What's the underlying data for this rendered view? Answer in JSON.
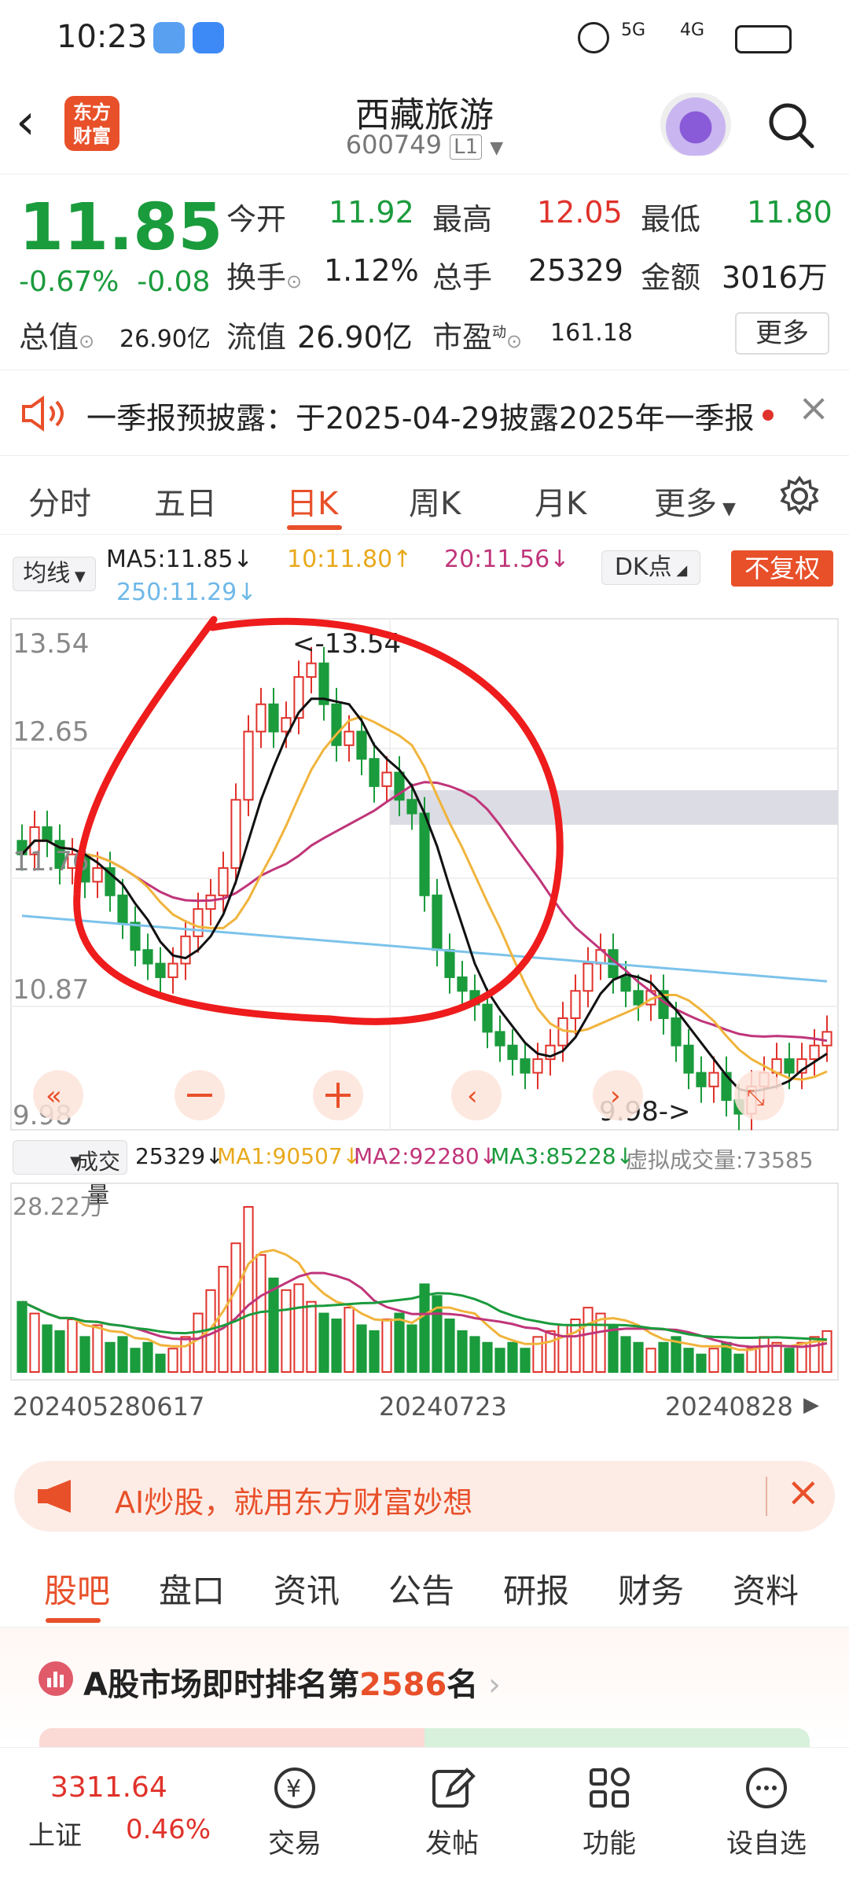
{
  "status": {
    "time": "10:23",
    "sig1": "5G",
    "sig2": "4G"
  },
  "header": {
    "logo_line1": "东方",
    "logo_line2": "财富",
    "title": "西藏旅游",
    "code": "600749",
    "level": "L1"
  },
  "quote": {
    "price": "11.85",
    "change_pct": "-0.67%",
    "change": "-0.08",
    "open_label": "今开",
    "open": "11.92",
    "high_label": "最高",
    "high": "12.05",
    "low_label": "最低",
    "low": "11.80",
    "turnover_label": "换手",
    "turnover": "1.12%",
    "volume_label": "总手",
    "volume": "25329",
    "amount_label": "金额",
    "amount": "3016万",
    "mktcap_label": "总值",
    "mktcap": "26.90亿",
    "float_label": "流值",
    "float": "26.90亿",
    "pe_label": "市盈",
    "pe_sup": "动",
    "pe": "161.18",
    "more": "更多"
  },
  "notice": {
    "text": "一季报预披露：于2025-04-29披露2025年一季报"
  },
  "tabs": [
    "分时",
    "五日",
    "日K",
    "周K",
    "月K",
    "更多"
  ],
  "ma": {
    "selector": "均线",
    "ma5": "MA5:11.85↓",
    "ma10": "10:11.80↑",
    "ma20": "20:11.56↓",
    "ma250": "250:11.29↓",
    "dk": "DK点",
    "fq": "不复权"
  },
  "chart_labels": {
    "y_top": "13.54",
    "y2": "12.65",
    "y3": "11.76",
    "y4": "10.87",
    "y_bottom": "9.98",
    "max_note": "<-13.54",
    "min_note": "9.98->"
  },
  "vol": {
    "selector": "成交量",
    "v": "25329↓",
    "ma1": "MA1:90507↓",
    "ma2": "MA2:92280↓",
    "ma3": "MA3:85228↓",
    "virtual": "虚拟成交量:73585",
    "max": "28.22万"
  },
  "dates": [
    "20240528",
    "0617",
    "20240723",
    "20240828"
  ],
  "banner": {
    "text": "AI炒股，就用东方财富妙想"
  },
  "bottom_tabs": [
    "股吧",
    "盘口",
    "资讯",
    "公告",
    "研报",
    "财务",
    "资料"
  ],
  "rank": {
    "prefix": "A股市场即时排名第",
    "num": "2586",
    "suffix": "名"
  },
  "footer": {
    "index_value": "3311.64",
    "index_name": "上证",
    "index_pct": "0.46%",
    "trade": "交易",
    "post": "发帖",
    "func": "功能",
    "watch": "设自选"
  },
  "colors": {
    "up": "#e0322b",
    "down": "#1a9b3c",
    "accent": "#e8502a"
  },
  "chart_data": {
    "type": "candlestick",
    "ylim": [
      9.98,
      13.54
    ],
    "high_point": 13.54,
    "low_point": 9.98,
    "x_ticks": [
      "20240528",
      "0617",
      "20240723",
      "20240828"
    ],
    "closes": [
      11.9,
      12.1,
      12.0,
      11.8,
      11.9,
      11.7,
      11.8,
      11.6,
      11.4,
      11.2,
      11.1,
      11.0,
      11.1,
      11.3,
      11.5,
      11.6,
      11.8,
      12.3,
      12.8,
      13.0,
      12.8,
      12.9,
      13.2,
      13.3,
      13.0,
      12.7,
      12.8,
      12.6,
      12.4,
      12.5,
      12.3,
      12.2,
      11.6,
      11.2,
      11.0,
      10.9,
      10.8,
      10.6,
      10.5,
      10.4,
      10.3,
      10.4,
      10.5,
      10.7,
      10.9,
      11.1,
      11.2,
      11.0,
      10.9,
      10.8,
      10.9,
      10.7,
      10.5,
      10.3,
      10.2,
      10.3,
      10.1,
      10.0,
      10.2,
      10.3,
      10.4,
      10.3,
      10.4,
      10.5,
      10.6
    ],
    "volumes_wan": [
      12,
      10,
      8,
      7,
      9,
      6,
      8,
      5,
      6,
      4,
      5,
      3,
      4,
      6,
      10,
      14,
      18,
      22,
      28.22,
      20,
      16,
      14,
      15,
      12,
      10,
      9,
      11,
      8,
      7,
      9,
      10,
      8,
      15,
      13,
      9,
      7,
      6,
      5,
      4,
      5,
      4,
      6,
      7,
      8,
      9,
      11,
      10,
      8,
      6,
      5,
      4,
      5,
      6,
      4,
      3,
      4,
      5,
      3,
      4,
      6,
      5,
      4,
      5,
      6,
      7
    ]
  }
}
